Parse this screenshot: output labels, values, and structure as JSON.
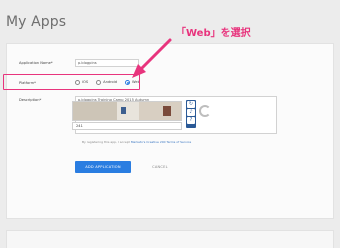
{
  "page": {
    "title": "My Apps"
  },
  "form": {
    "app_name": {
      "label": "Application Name*",
      "value": "p.blogpins"
    },
    "platform": {
      "label": "Platform*",
      "options": [
        "iOS",
        "Android",
        "Web"
      ],
      "selected": "Web"
    },
    "description": {
      "label": "Description*",
      "value": "p.blogpins Training Camp 2015 Autumn"
    },
    "captcha": {
      "answer": "241"
    },
    "terms": {
      "prefix": "By registering this app, I accept",
      "link": "Marketo's Creative 200 Terms of Service"
    },
    "add_button": "ADD APPLICATION",
    "cancel_button": "CANCEL"
  },
  "annotation": {
    "text": "「Web」を選択"
  },
  "colors": {
    "accent": "#2a7de1",
    "highlight": "#e8347d"
  }
}
